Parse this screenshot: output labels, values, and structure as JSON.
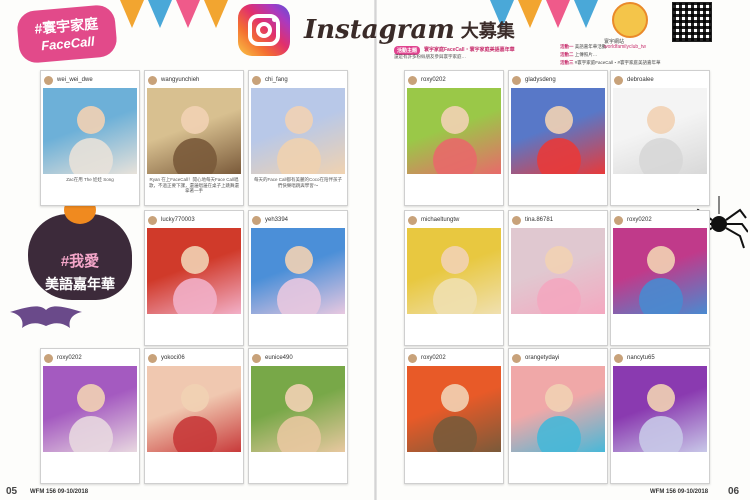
{
  "magazine": {
    "title": "Instagram",
    "title_cn": "大募集",
    "badge_facecall_l1": "#寰宇家庭",
    "badge_facecall_l2": "FaceCall",
    "badge_carnival_l1": "#我愛",
    "badge_carnival_l2": "美語嘉年華"
  },
  "header_right": {
    "pill": "活動主題",
    "line1": "寰宇家庭FaceCall・寰宇家庭美語嘉年華",
    "line2": "還是有許多粉絲朋友參與寰宇家庭…",
    "r1_key": "活動一",
    "r1": "美語嘉年華活動",
    "r2_key": "活動二",
    "r2": "上傳照片…",
    "r3_key": "活動三",
    "r3": "#寰宇家庭FaceCall・#寰宇家庭美語嘉年華"
  },
  "mascot": {
    "label": "寰宇網站",
    "url": "worldfamilyclub_tw"
  },
  "posts": [
    {
      "user": "wei_wei_dwe",
      "caption": "Zac在用 The 娃娃 Song",
      "bg": [
        "#6db0d8",
        "#e8e2da"
      ]
    },
    {
      "user": "wangyunchieh",
      "caption": "Ryan 在上FaceCall！開心地每天Face Call唱歌，不過正要下課，還邊唱邊在桌子上跳舞還拿著一手",
      "bg": [
        "#d8c090",
        "#7a5a3a"
      ]
    },
    {
      "user": "chi_fang",
      "caption": "每天的Face Call都有美麗的Coco在陪伴孩子們快樂唱跳與學習～",
      "bg": [
        "#b8c8e8",
        "#f0d2b0"
      ]
    },
    {
      "user": "lucky770003",
      "caption": "",
      "bg": [
        "#d03a2a",
        "#f2b0c8"
      ]
    },
    {
      "user": "yeh3394",
      "caption": "",
      "bg": [
        "#4b8fd8",
        "#e8c8e0"
      ]
    },
    {
      "user": "roxy0202",
      "caption": "",
      "bg": [
        "#a45ac0",
        "#e8d8e0"
      ]
    },
    {
      "user": "yokoci06",
      "caption": "",
      "bg": [
        "#f0c8b0",
        "#c83a3a"
      ]
    },
    {
      "user": "eunice490",
      "caption": "",
      "bg": [
        "#78a848",
        "#e8c8a0"
      ]
    },
    {
      "user": "roxy0202",
      "caption": "",
      "bg": [
        "#9ac848",
        "#e86a6a"
      ]
    },
    {
      "user": "gladysdeng",
      "caption": "",
      "bg": [
        "#5878c8",
        "#e83a3a"
      ]
    },
    {
      "user": "debroalee",
      "caption": "",
      "bg": [
        "#f4f4f4",
        "#d8d8d8"
      ]
    },
    {
      "user": "michaeltungtw",
      "caption": "",
      "bg": [
        "#e8c840",
        "#f0e0b0"
      ]
    },
    {
      "user": "tina.86781",
      "caption": "",
      "bg": [
        "#e0c8d0",
        "#f4a8c0"
      ]
    },
    {
      "user": "roxy0202",
      "caption": "",
      "bg": [
        "#c03a8a",
        "#4a8ad0"
      ]
    },
    {
      "user": "roxy0202",
      "caption": "",
      "bg": [
        "#e85a28",
        "#7a5a3a"
      ]
    },
    {
      "user": "orangetydayi",
      "caption": "",
      "bg": [
        "#f0a8a8",
        "#48b8d8"
      ]
    },
    {
      "user": "nancytu65",
      "caption": "",
      "bg": [
        "#8a3ab0",
        "#c8c8e8"
      ]
    }
  ],
  "footer": {
    "left_page": "05",
    "right_page": "06",
    "left_label": "WFM 156  09-10/2018",
    "right_label": "WFM 156  09-10/2018"
  }
}
